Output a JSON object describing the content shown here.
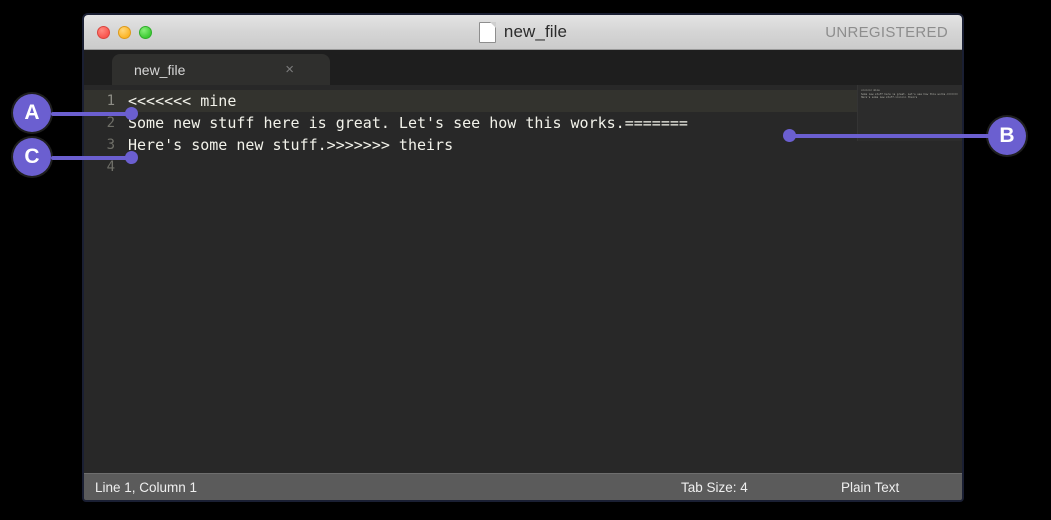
{
  "window": {
    "title": "new_file",
    "watermark": "UNREGISTERED",
    "traffic_lights": [
      "close-red",
      "minimize-yellow",
      "maximize-green"
    ]
  },
  "tab": {
    "label": "new_file",
    "close_glyph": "×"
  },
  "editor": {
    "gutter": [
      "1",
      "2",
      "3",
      "4"
    ],
    "lines": [
      "<<<<<<< mine",
      "Some new stuff here is great. Let's see how this works.=======",
      "Here's some new stuff.>>>>>>> theirs",
      ""
    ],
    "active_line_index": 0,
    "minimap_lines": [
      "<<<<<<< mine",
      "Some new stuff here is great. Let's see how this works.=======",
      "Here's some new stuff.>>>>>>> theirs"
    ]
  },
  "status_bar": {
    "position": "Line 1, Column 1",
    "tab_size": "Tab Size: 4",
    "syntax": "Plain Text"
  },
  "annotations": {
    "accent_color": "#6b5fd0",
    "markers": [
      {
        "label": "A",
        "target": "line-1-conflict-marker-mine"
      },
      {
        "label": "B",
        "target": "line-2-conflict-separator"
      },
      {
        "label": "C",
        "target": "line-3-conflict-marker-theirs"
      }
    ]
  }
}
